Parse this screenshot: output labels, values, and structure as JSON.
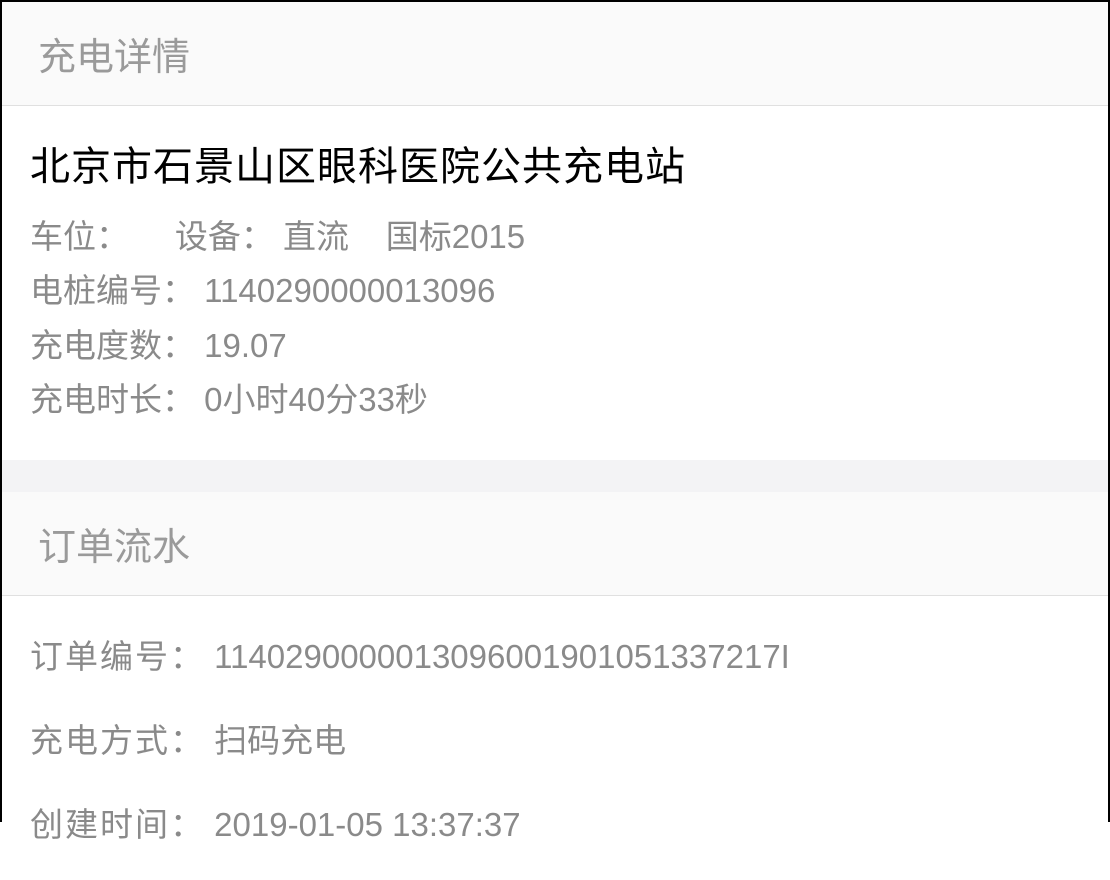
{
  "charging_details": {
    "header": "充电详情",
    "station_name": "北京市石景山区眼科医院公共充电站",
    "parking_label": "车位：",
    "parking_value": "",
    "equipment_label": "设备：",
    "equipment_type": "直流",
    "equipment_standard": "国标2015",
    "pile_id_label": "电桩编号：",
    "pile_id_value": "1140290000013096",
    "kwh_label": "充电度数：",
    "kwh_value": "19.07",
    "duration_label": "充电时长：",
    "duration_value": "0小时40分33秒"
  },
  "order_flow": {
    "header": "订单流水",
    "order_id_label": "订单编号：",
    "order_id_value": "1140290000013096001901051337217I",
    "method_label": "充电方式：",
    "method_value": "扫码充电",
    "created_label": "创建时间：",
    "created_value": "2019-01-05 13:37:37"
  }
}
